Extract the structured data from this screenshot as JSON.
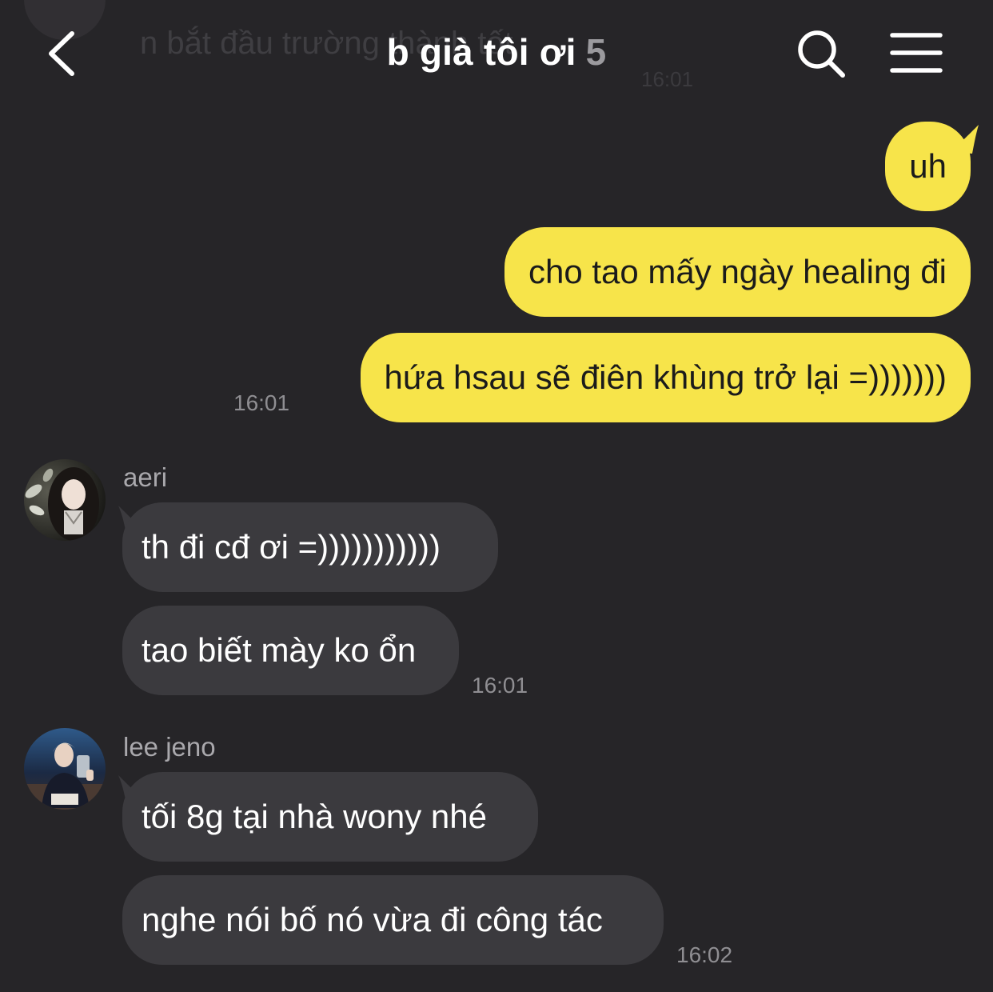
{
  "header": {
    "title": "b già tôi ơi",
    "member_count": "5",
    "back_icon": "chevron-left-icon",
    "search_icon": "search-icon",
    "menu_icon": "hamburger-menu-icon"
  },
  "ghost": {
    "text": "n bắt đầu trường thành tốt",
    "time": "16:01"
  },
  "colors": {
    "background": "#262528",
    "my_bubble": "#f7e44a",
    "other_bubble": "#3b3a3e",
    "timestamp": "#8f8e92"
  },
  "outgoing": {
    "messages": [
      {
        "text": "uh"
      },
      {
        "text": "cho tao mấy ngày healing đi"
      },
      {
        "text": "hứa hsau sẽ điên khùng trở lại =)))))))"
      }
    ],
    "time": "16:01"
  },
  "groups": [
    {
      "sender": "aeri",
      "messages": [
        {
          "text": "th đi cđ ơi =)))))))))))"
        },
        {
          "text": "tao biết mày ko ổn"
        }
      ],
      "time": "16:01"
    },
    {
      "sender": "lee jeno",
      "messages": [
        {
          "text": "tối 8g tại nhà wony nhé"
        },
        {
          "text": "nghe nói bố nó vừa đi công tác"
        }
      ],
      "time": "16:02"
    }
  ]
}
